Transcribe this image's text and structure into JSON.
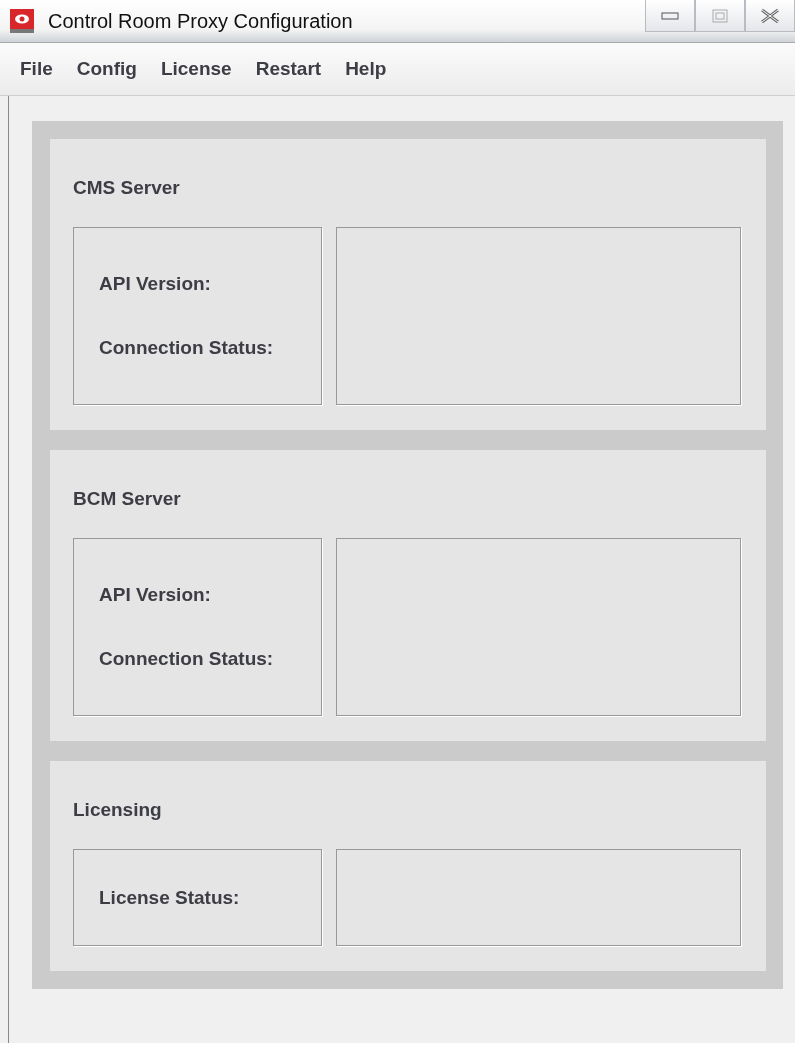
{
  "window": {
    "title": "Control Room Proxy Configuration"
  },
  "menu": [
    "File",
    "Config",
    "License",
    "Restart",
    "Help"
  ],
  "panels": [
    {
      "title": "CMS Server",
      "fields": [
        "API Version:",
        "Connection Status:"
      ]
    },
    {
      "title": "BCM Server",
      "fields": [
        "API Version:",
        "Connection Status:"
      ]
    },
    {
      "title": "Licensing",
      "fields": [
        "License Status:"
      ]
    }
  ]
}
